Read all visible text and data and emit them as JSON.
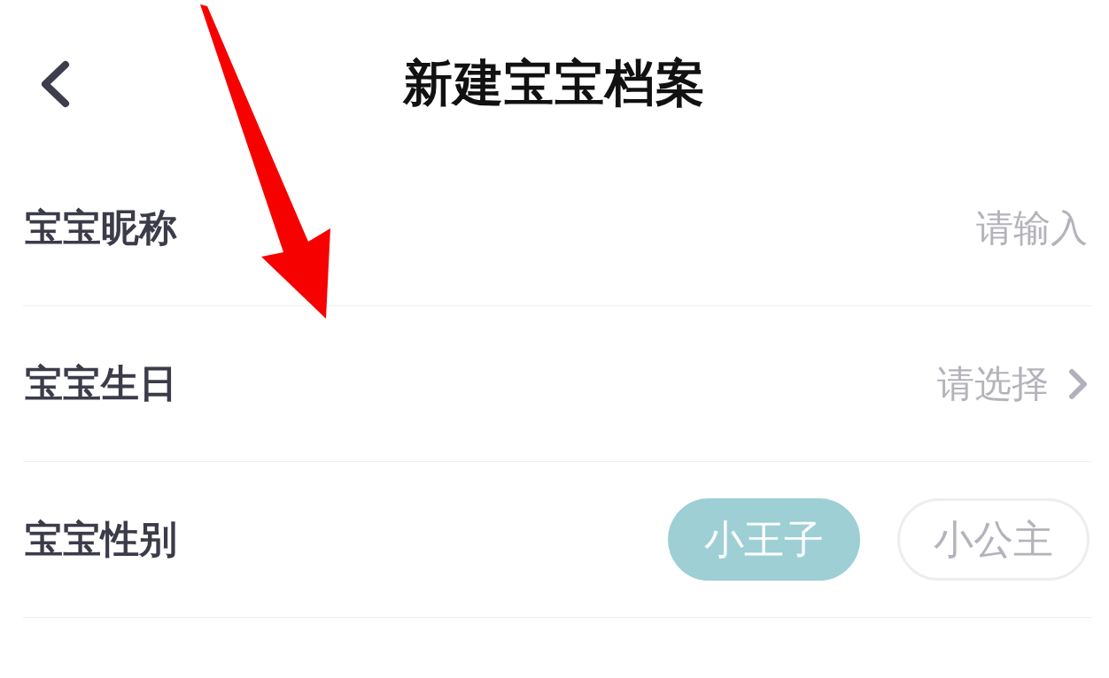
{
  "header": {
    "title": "新建宝宝档案"
  },
  "rows": [
    {
      "kind": "input",
      "label": "宝宝昵称",
      "placeholder": "请输入"
    },
    {
      "kind": "picker",
      "label": "宝宝生日",
      "placeholder": "请选择"
    },
    {
      "kind": "choice",
      "label": "宝宝性别",
      "options": [
        {
          "label": "小王子",
          "selected": true
        },
        {
          "label": "小公主",
          "selected": false
        }
      ]
    }
  ]
}
